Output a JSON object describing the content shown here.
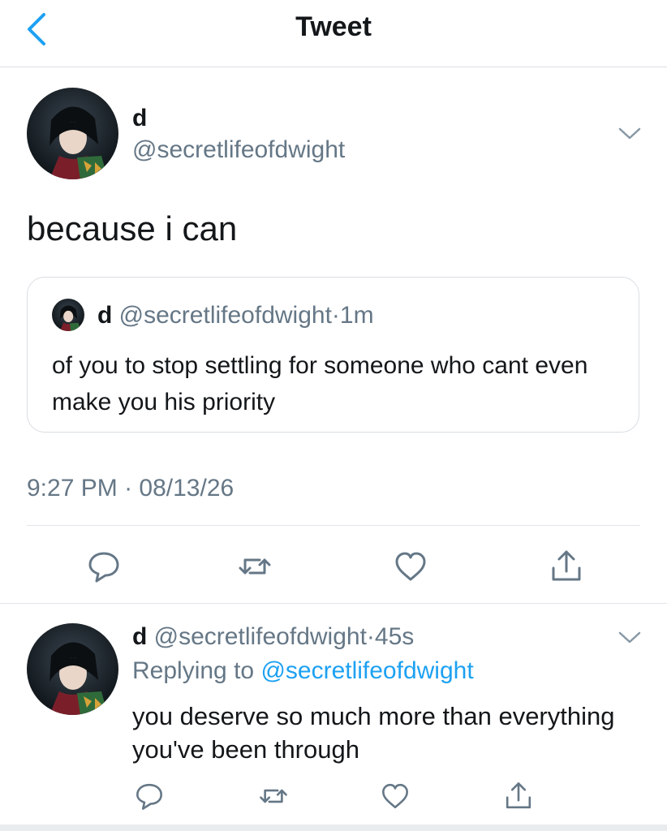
{
  "header": {
    "title": "Tweet"
  },
  "tweet": {
    "name": "d",
    "handle": "@secretlifeofdwight",
    "text": "because i can",
    "quoted": {
      "name": "d",
      "handle": "@secretlifeofdwight",
      "separator": "·",
      "time": "1m",
      "text": "of you to stop settling for someone who cant even make you his priority"
    },
    "time": "9:27 PM",
    "separator": "·",
    "date": "08/13/26"
  },
  "reply": {
    "name": "d",
    "handle": "@secretlifeofdwight",
    "separator": "·",
    "time": "45s",
    "replying_prefix": "Replying to",
    "replying_to": "@secretlifeofdwight",
    "text": "you deserve so much more than everything you've been through"
  },
  "icons": {
    "back": "chevron-left-icon",
    "more": "chevron-down-icon",
    "reply": "comment-icon",
    "retweet": "retweet-icon",
    "like": "heart-icon",
    "share": "share-icon"
  },
  "colors": {
    "accent": "#1da1f2",
    "text": "#14171a",
    "secondary": "#657786",
    "border": "#e1e5e8"
  }
}
